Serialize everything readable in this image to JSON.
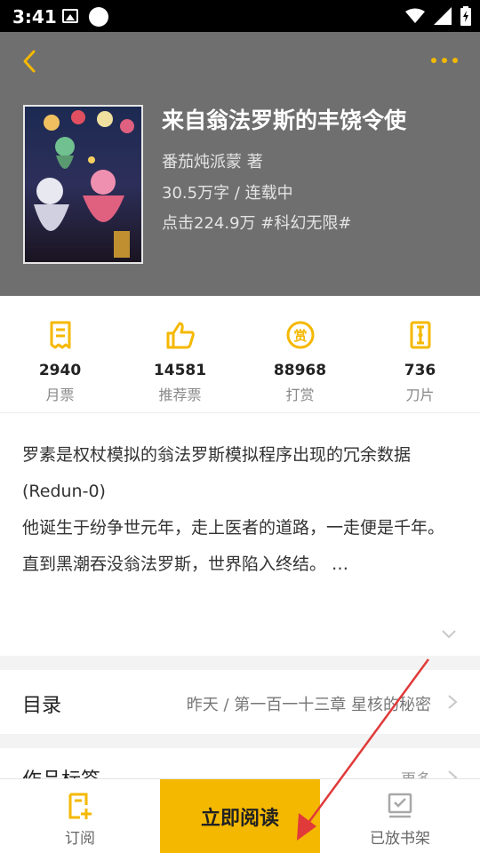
{
  "status_bar": {
    "time": "3:41"
  },
  "header": {
    "title": "来自翁法罗斯的丰饶令使",
    "author": "番茄炖派蒙  著",
    "words_status": "30.5万字 / 连载中",
    "clicks_tag": "点击224.9万  #科幻无限#",
    "accent_color": "#f5b800"
  },
  "stats": [
    {
      "icon": "monthly-ticket-icon",
      "value": "2940",
      "label": "月票"
    },
    {
      "icon": "thumbs-up-icon",
      "value": "14581",
      "label": "推荐票"
    },
    {
      "icon": "reward-coin-icon",
      "value": "88968",
      "label": "打赏"
    },
    {
      "icon": "blade-icon",
      "value": "736",
      "label": "刀片"
    }
  ],
  "description": {
    "line1": "罗素是权杖模拟的翁法罗斯模拟程序出现的冗余数据(Redun-0)",
    "line2": "他诞生于纷争世元年，走上医者的道路，一走便是千年。",
    "line3": "直到黑潮吞没翁法罗斯，世界陷入终结。 …"
  },
  "toc": {
    "label": "目录",
    "latest": "昨天 / 第一百一十三章 星核的秘密"
  },
  "tags": {
    "label": "作品标签",
    "more": "更多"
  },
  "bottom_bar": {
    "subscribe": "订阅",
    "read_now": "立即阅读",
    "shelved": "已放书架"
  }
}
